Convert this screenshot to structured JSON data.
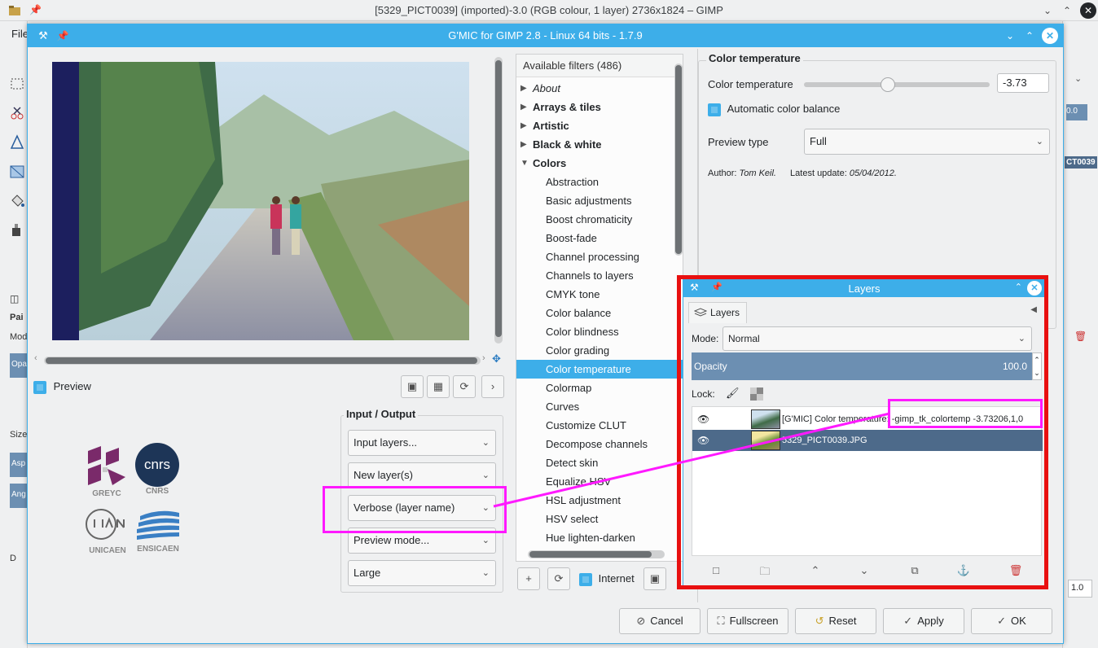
{
  "gimp_window": {
    "title": "[5329_PICT0039] (imported)-3.0 (RGB colour, 1 layer) 2736x1824 – GIMP",
    "menu_file": "File",
    "tool_options_title": "Pai",
    "mode_label": "Mod",
    "opacity_short": "Opa",
    "size_short": "Size",
    "aspect_short": "Asp",
    "angle_short": "Ang",
    "dyn_short": "D",
    "right_value": "0.0",
    "right_label": "CT0039",
    "right_spin": "1.0"
  },
  "gmic": {
    "title": "G'MIC for GIMP 2.8 - Linux 64 bits - 1.7.9",
    "preview_label": "Preview",
    "logos": {
      "greyc": "GREYC",
      "cnrs": "CNRS",
      "unicaen": "UNICAEN",
      "ensicaen": "ENSICAEN",
      "cnrs_mark": "cnrs"
    },
    "io": {
      "title": "Input / Output",
      "input_layers": "Input layers...",
      "output_mode": "New layer(s)",
      "verbosity": "Verbose (layer name)",
      "preview_mode": "Preview mode...",
      "preview_size": "Large"
    },
    "filters": {
      "header": "Available filters (486)",
      "categories_top": [
        {
          "label": "About",
          "italic": true
        },
        {
          "label": "Arrays & tiles"
        },
        {
          "label": "Artistic"
        },
        {
          "label": "Black & white"
        },
        {
          "label": "Colors"
        }
      ],
      "colors_items": [
        "Abstraction",
        "Basic adjustments",
        "Boost chromaticity",
        "Boost-fade",
        "Channel processing",
        "Channels to layers",
        "CMYK tone",
        "Color balance",
        "Color blindness",
        "Color grading",
        "Color temperature",
        "Colormap",
        "Curves",
        "Customize CLUT",
        "Decompose channels",
        "Detect skin",
        "Equalize HSV",
        "HSL adjustment",
        "HSV select",
        "Hue lighten-darken"
      ],
      "selected": "Color temperature",
      "internet_label": "Internet"
    },
    "params": {
      "title": "Color temperature",
      "temp_label": "Color temperature",
      "temp_value": "-3.73",
      "temp_fraction": 0.45,
      "auto_balance_label": "Automatic color balance",
      "preview_type_label": "Preview type",
      "preview_type_value": "Full",
      "author_prefix": "Author:",
      "author_name": "Tom Keil.",
      "update_prefix": "Latest update:",
      "update_date": "05/04/2012."
    },
    "buttons": {
      "cancel": "Cancel",
      "fullscreen": "Fullscreen",
      "reset": "Reset",
      "apply": "Apply",
      "ok": "OK"
    }
  },
  "layers": {
    "title": "Layers",
    "tab": "Layers",
    "mode_label": "Mode:",
    "mode_value": "Normal",
    "opacity_label": "Opacity",
    "opacity_value": "100.0",
    "lock_label": "Lock:",
    "rows": [
      {
        "name": "[G'MIC] Color temperature: -gimp_tk_colortemp -3.73206,1,0",
        "selected": false
      },
      {
        "name": "5329_PICT0039.JPG",
        "selected": true
      }
    ]
  },
  "colors": {
    "accent": "#3daee9",
    "annotation_red": "#e81010",
    "annotation_magenta": "#ff19ff",
    "selected_layer": "#4d6a8a"
  }
}
